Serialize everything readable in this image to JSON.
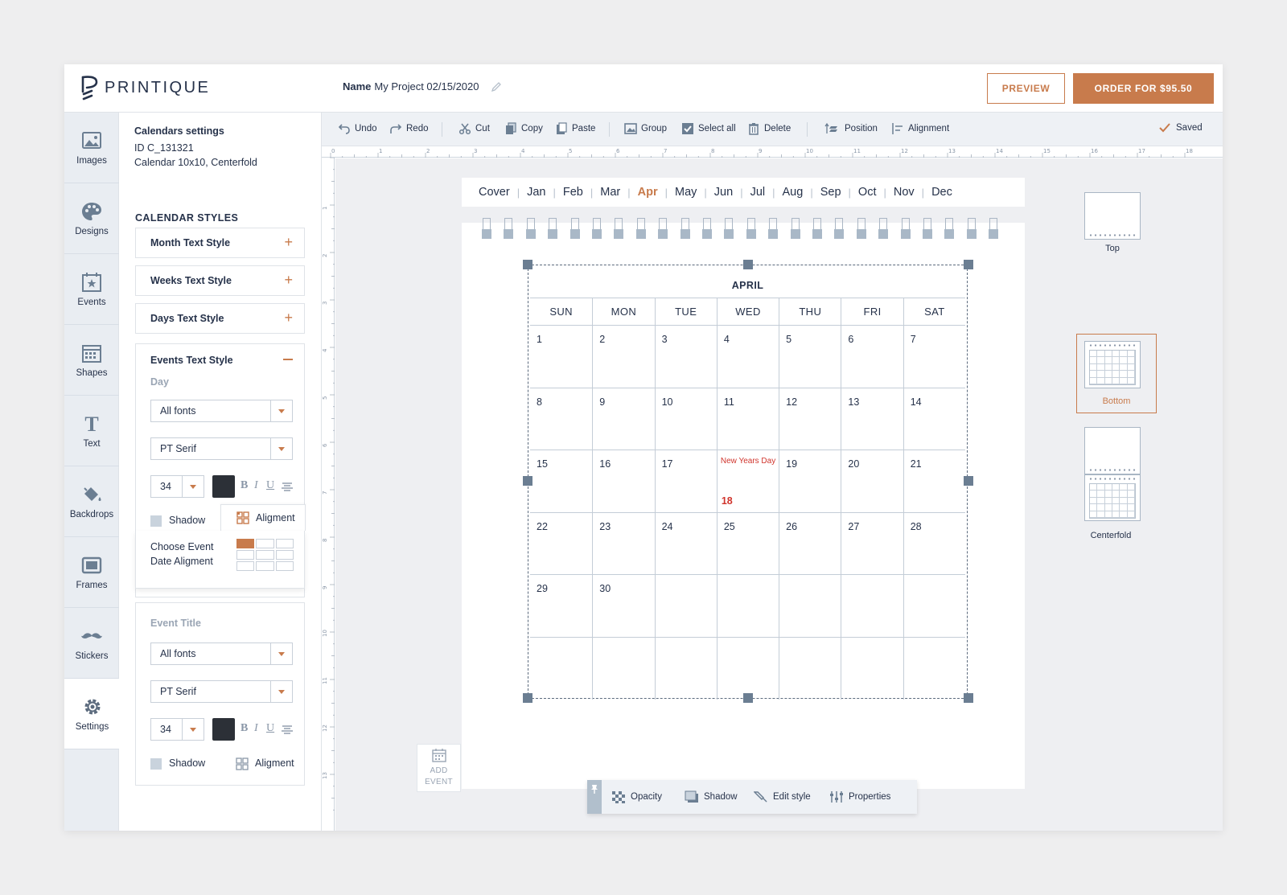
{
  "header": {
    "brand": "PRINTIQUE",
    "name_label": "Name",
    "project_name": "My Project 02/15/2020",
    "preview_label": "PREVIEW",
    "order_label": "ORDER FOR $95.50"
  },
  "nav": {
    "items": [
      {
        "label": "Images",
        "icon": "image-icon"
      },
      {
        "label": "Designs",
        "icon": "palette-icon"
      },
      {
        "label": "Events",
        "icon": "calendar-star-icon"
      },
      {
        "label": "Shapes",
        "icon": "calendar-grid-icon"
      },
      {
        "label": "Text",
        "icon": "text-icon"
      },
      {
        "label": "Backdrops",
        "icon": "paint-bucket-icon"
      },
      {
        "label": "Frames",
        "icon": "frame-icon"
      },
      {
        "label": "Stickers",
        "icon": "mustache-icon"
      },
      {
        "label": "Settings",
        "icon": "gear-icon"
      }
    ],
    "active": "Settings"
  },
  "panel": {
    "title": "Calendars settings",
    "id_line": "ID C_131321",
    "desc_line": "Calendar 10x10, Centerfold",
    "styles_heading": "CALENDAR STYLES",
    "accordions": [
      "Month Text Style",
      "Weeks Text Style",
      "Days Text Style"
    ],
    "events": {
      "title": "Events Text Style",
      "day_heading": "Day",
      "font_group": "All fonts",
      "font_family": "PT Serif",
      "font_size": "34",
      "bold": "B",
      "italic": "I",
      "underline": "U",
      "shadow_label": "Shadow",
      "alignment_label": "Aligment",
      "choose_alignment": "Choose Event Date Aligment",
      "event_title_heading": "Event Title",
      "et_font_group": "All fonts",
      "et_font_family": "PT Serif",
      "et_font_size": "34",
      "et_shadow_label": "Shadow",
      "et_alignment_label": "Aligment"
    }
  },
  "toolbar": {
    "undo": "Undo",
    "redo": "Redo",
    "cut": "Cut",
    "copy": "Copy",
    "paste": "Paste",
    "group": "Group",
    "select_all": "Select all",
    "delete": "Delete",
    "position": "Position",
    "alignment": "Alignment",
    "saved": "Saved"
  },
  "ruler": {
    "top": [
      "0",
      "1",
      "2",
      "3",
      "4",
      "5",
      "6",
      "7",
      "8",
      "9",
      "10",
      "11",
      "12",
      "13",
      "14",
      "15",
      "16",
      "17",
      "18"
    ],
    "left": [
      "1",
      "2",
      "3",
      "4",
      "5",
      "6",
      "7",
      "8",
      "9",
      "10",
      "11",
      "12",
      "13"
    ]
  },
  "months": [
    "Cover",
    "Jan",
    "Feb",
    "Mar",
    "Apr",
    "May",
    "Jun",
    "Jul",
    "Aug",
    "Sep",
    "Oct",
    "Nov",
    "Dec"
  ],
  "active_month": "Apr",
  "calendar": {
    "title": "APRIL",
    "weekdays": [
      "SUN",
      "MON",
      "TUE",
      "WED",
      "THU",
      "FRI",
      "SAT"
    ],
    "weeks": [
      [
        "1",
        "2",
        "3",
        "4",
        "5",
        "6",
        "7"
      ],
      [
        "8",
        "9",
        "10",
        "11",
        "12",
        "13",
        "14"
      ],
      [
        "15",
        "16",
        "17",
        "18",
        "19",
        "20",
        "21"
      ],
      [
        "22",
        "23",
        "24",
        "25",
        "26",
        "27",
        "28"
      ],
      [
        "29",
        "30",
        "",
        "",
        "",
        "",
        ""
      ],
      [
        "",
        "",
        "",
        "",
        "",
        "",
        ""
      ]
    ],
    "event": {
      "day": "18",
      "title": "New Years Day"
    }
  },
  "add_event": {
    "line1": "ADD",
    "line2": "EVENT"
  },
  "float_toolbar": {
    "opacity": "Opacity",
    "shadow": "Shadow",
    "edit_style": "Edit style",
    "properties": "Properties"
  },
  "layouts": [
    {
      "label": "Top"
    },
    {
      "label": "Bottom"
    },
    {
      "label": "Centerfold"
    }
  ],
  "selected_layout": "Bottom",
  "colors": {
    "accent": "#c87b4c",
    "text": "#26324a",
    "event": "#d0342c",
    "nav_bg": "#e9edf2",
    "swatch": "#2c3037"
  }
}
